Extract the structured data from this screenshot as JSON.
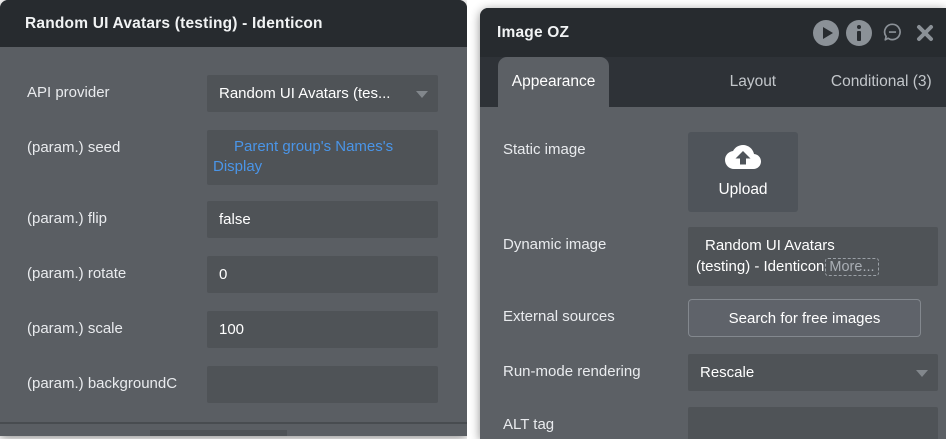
{
  "left_panel": {
    "title": "Random UI Avatars (testing) - Identicon",
    "fields": [
      {
        "label": "API provider",
        "type": "dropdown",
        "value": "Random UI Avatars (tes..."
      },
      {
        "label": "(param.) seed",
        "type": "expression",
        "value": "Parent group's Names's Display"
      },
      {
        "label": "(param.) flip",
        "type": "text",
        "value": "false"
      },
      {
        "label": "(param.) rotate",
        "type": "text",
        "value": "0"
      },
      {
        "label": "(param.) scale",
        "type": "text",
        "value": "100"
      },
      {
        "label": "(param.) backgroundC",
        "type": "text",
        "value": ""
      }
    ]
  },
  "right_panel": {
    "title": "Image OZ",
    "header_icons": [
      "play-icon",
      "info-icon",
      "comment-icon",
      "close-icon"
    ],
    "tabs": [
      {
        "label": "Appearance",
        "active": true
      },
      {
        "label": "Layout",
        "active": false
      },
      {
        "label": "Conditional (3)",
        "active": false
      }
    ],
    "static_image": {
      "label": "Static image",
      "upload_label": "Upload"
    },
    "dynamic_image": {
      "label": "Dynamic image",
      "value_lines": [
        "Random UI Avatars",
        "(testing) - Identicon"
      ],
      "more_label": "More..."
    },
    "external_sources": {
      "label": "External sources",
      "button_label": "Search for free images"
    },
    "run_mode": {
      "label": "Run-mode rendering",
      "value": "Rescale"
    },
    "alt_tag": {
      "label": "ALT tag",
      "value": ""
    }
  },
  "colors": {
    "accent_blue": "#4a95e8",
    "panel_header": "#272b2f",
    "tabbar": "#2e3237",
    "panel_body": "#5c6065",
    "field_bg": "#4f5357",
    "icon_gray": "#8b9197"
  }
}
